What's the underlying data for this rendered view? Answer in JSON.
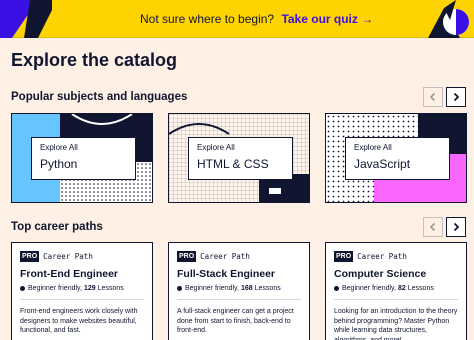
{
  "banner": {
    "text": "Not sure where to begin?",
    "cta": "Take our quiz →"
  },
  "page": {
    "title": "Explore the catalog"
  },
  "popular": {
    "heading": "Popular subjects and languages",
    "cards": [
      {
        "kicker": "Explore All",
        "name": "Python"
      },
      {
        "kicker": "Explore All",
        "name": "HTML & CSS"
      },
      {
        "kicker": "Explore All",
        "name": "JavaScript"
      }
    ]
  },
  "careers": {
    "heading": "Top career paths",
    "cards": [
      {
        "badge": "PRO",
        "kind": "Career Path",
        "title": "Front-End Engineer",
        "level": "Beginner friendly,",
        "count": "129",
        "count_label": "Lessons",
        "desc": "Front-end engineers work closely with designers to make websites beautiful, functional, and fast."
      },
      {
        "badge": "PRO",
        "kind": "Career Path",
        "title": "Full-Stack Engineer",
        "level": "Beginner friendly,",
        "count": "168",
        "count_label": "Lessons",
        "desc": "A full-stack engineer can get a project done from start to finish, back-end to front-end."
      },
      {
        "badge": "PRO",
        "kind": "Career Path",
        "title": "Computer Science",
        "level": "Beginner friendly,",
        "count": "82",
        "count_label": "Lessons",
        "desc": "Looking for an introduction to the theory behind programming? Master Python while learning data structures, algorithms, and more!"
      }
    ]
  },
  "colors": {
    "banner": "#ffd300",
    "accent": "#3a10e5",
    "navy": "#10162f",
    "blue": "#66c4ff",
    "pink": "#f966ff",
    "bg": "#fff0e5"
  }
}
